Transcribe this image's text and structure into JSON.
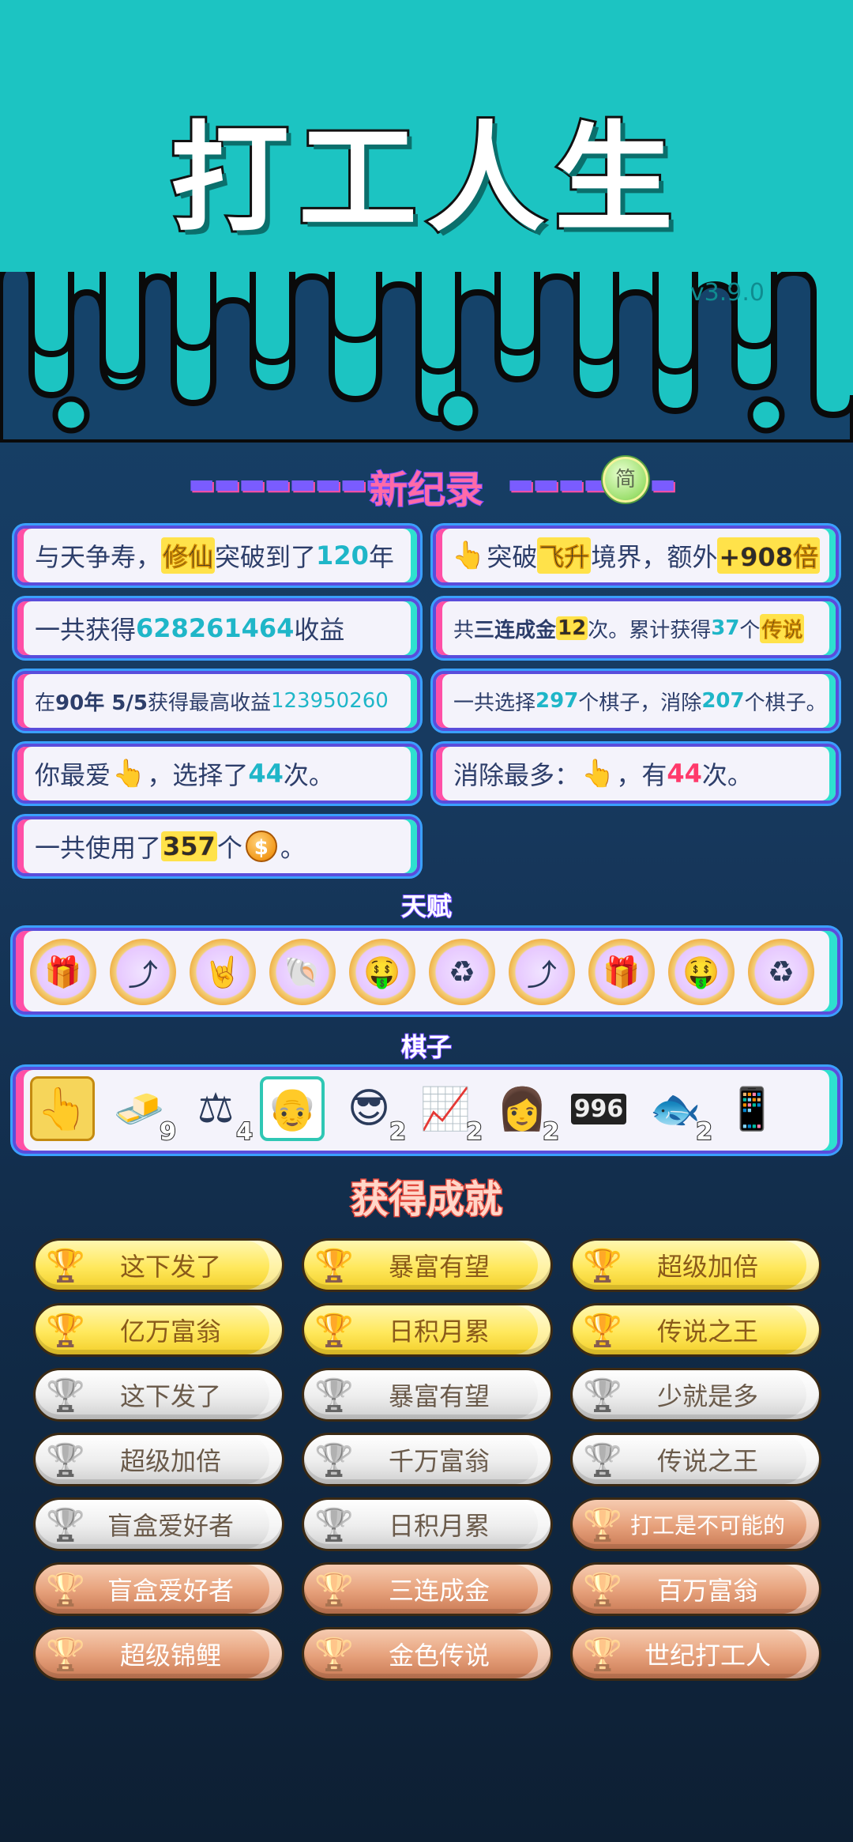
{
  "header": {
    "title": "打工人生",
    "version": "v3.9.0"
  },
  "record": {
    "title": "新纪录",
    "simp_button": "简"
  },
  "stats": {
    "c1": {
      "a": "与天争寿，",
      "b": "修仙",
      "c": "突破到了",
      "d": "120",
      "e": "年"
    },
    "c2": {
      "a": "突破",
      "b": "飞升",
      "c": "境界，额外",
      "d": "+908倍"
    },
    "c3": {
      "a": "一共获得",
      "b": "628261464",
      "c": "收益"
    },
    "c4": {
      "a": "共",
      "b": "三连成金",
      "c": "12",
      "d": "次。累计获得",
      "e": "37",
      "f": "个",
      "g": "传说"
    },
    "c5": {
      "a": "在 ",
      "b": "90年 5/5",
      "c": " 获得最高收益",
      "d": "123950260"
    },
    "c6": {
      "a": "一共选择",
      "b": "297",
      "c": "个棋子，消除",
      "d": "207",
      "e": "个棋子。"
    },
    "c7": {
      "a": "你最爱",
      "b": "，选择了",
      "c": "44",
      "d": "次。"
    },
    "c8": {
      "a": "消除最多：",
      "b": "，有",
      "c": "44",
      "d": "次。"
    },
    "c9": {
      "a": "一共使用了",
      "b": "357",
      "c": "个",
      "coin": "$",
      "d": "。"
    }
  },
  "talent_label": "天赋",
  "talents": [
    {
      "icon": "gift-box-icon",
      "glyph": "🎁"
    },
    {
      "icon": "arrow-up-icon",
      "glyph": "⤴"
    },
    {
      "icon": "rock-hand-icon",
      "glyph": "🤘"
    },
    {
      "icon": "shell-icon",
      "glyph": "🐚"
    },
    {
      "icon": "rich-man-icon",
      "glyph": "🤑"
    },
    {
      "icon": "recycle-icon",
      "glyph": "♻"
    },
    {
      "icon": "arrow-up-icon",
      "glyph": "⤴"
    },
    {
      "icon": "gift-box-icon",
      "glyph": "🎁"
    },
    {
      "icon": "rich-man-icon",
      "glyph": "🤑"
    },
    {
      "icon": "recycle-icon",
      "glyph": "♻"
    }
  ],
  "pieces_label": "棋子",
  "pieces": [
    {
      "icon": "pointing-hand-icon",
      "glyph": "👆",
      "count": ""
    },
    {
      "icon": "gold-bars-icon",
      "glyph": "🧈",
      "count": "9"
    },
    {
      "icon": "scales-icon",
      "glyph": "⚖",
      "count": "4"
    },
    {
      "icon": "old-man-icon",
      "glyph": "👴",
      "count": ""
    },
    {
      "icon": "cool-guy-icon",
      "glyph": "😎",
      "count": "2"
    },
    {
      "icon": "stock-chart-icon",
      "glyph": "📈",
      "count": "2"
    },
    {
      "icon": "woman-icon",
      "glyph": "👩",
      "count": "2"
    },
    {
      "icon": "996-icon",
      "glyph": "996",
      "count": ""
    },
    {
      "icon": "koi-fish-icon",
      "glyph": "🐟",
      "count": "2"
    },
    {
      "icon": "phone-icon",
      "glyph": "📱",
      "count": ""
    }
  ],
  "achievements_title": "获得成就",
  "achievements": [
    {
      "label": "这下发了",
      "tier": "gold"
    },
    {
      "label": "暴富有望",
      "tier": "gold"
    },
    {
      "label": "超级加倍",
      "tier": "gold"
    },
    {
      "label": "亿万富翁",
      "tier": "gold"
    },
    {
      "label": "日积月累",
      "tier": "gold"
    },
    {
      "label": "传说之王",
      "tier": "gold"
    },
    {
      "label": "这下发了",
      "tier": "silver"
    },
    {
      "label": "暴富有望",
      "tier": "silver"
    },
    {
      "label": "少就是多",
      "tier": "silver"
    },
    {
      "label": "超级加倍",
      "tier": "silver"
    },
    {
      "label": "千万富翁",
      "tier": "silver"
    },
    {
      "label": "传说之王",
      "tier": "silver"
    },
    {
      "label": "盲盒爱好者",
      "tier": "silver"
    },
    {
      "label": "日积月累",
      "tier": "silver"
    },
    {
      "label": "打工是不可能的",
      "tier": "bronze"
    },
    {
      "label": "盲盒爱好者",
      "tier": "bronze"
    },
    {
      "label": "三连成金",
      "tier": "bronze"
    },
    {
      "label": "百万富翁",
      "tier": "bronze"
    },
    {
      "label": "超级锦鲤",
      "tier": "bronze"
    },
    {
      "label": "金色传说",
      "tier": "bronze"
    },
    {
      "label": "世纪打工人",
      "tier": "bronze"
    }
  ],
  "colors": {
    "header_teal": "#1cc4c2",
    "navy": "#173a60",
    "accent_purple": "#5a4ddb",
    "accent_pink": "#ff4fa6",
    "accent_cyan": "#2ee0cf"
  }
}
